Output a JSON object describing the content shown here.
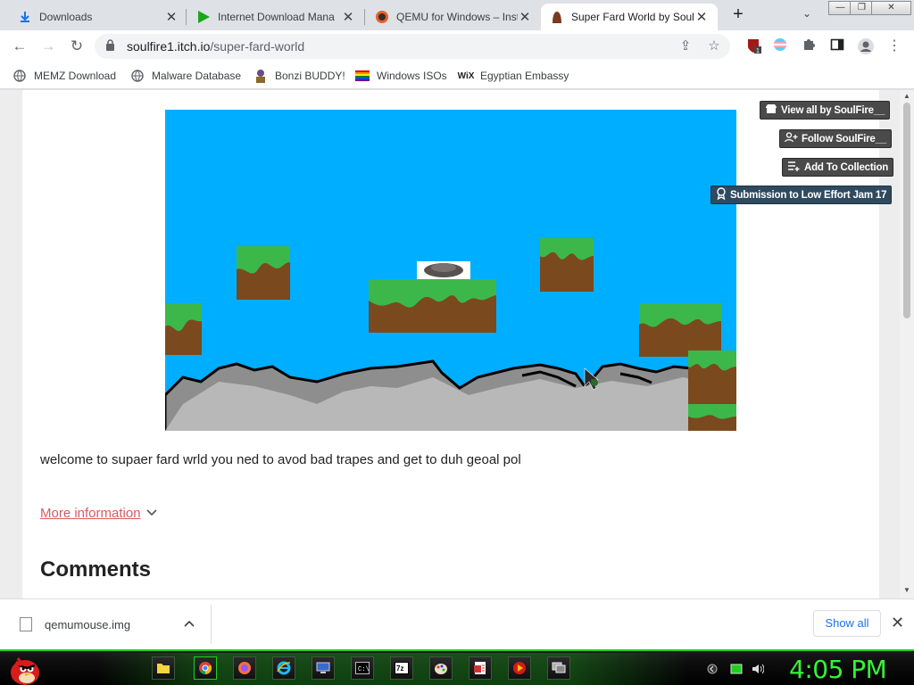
{
  "browser": {
    "tabs": [
      {
        "title": "Downloads",
        "icon": "download-icon",
        "active": false
      },
      {
        "title": "Internet Download Mana",
        "icon": "idm-play-icon",
        "active": false
      },
      {
        "title": "QEMU for Windows – Inst",
        "icon": "qemu-icon",
        "active": false
      },
      {
        "title": "Super Fard World by Soul",
        "icon": "itch-page-icon",
        "active": true
      }
    ],
    "new_tab_label": "+",
    "tab_search_label": "⌄",
    "url_host": "soulfire1.itch.io",
    "url_path": "/super-fard-world",
    "extension_badge": "1",
    "window_controls": {
      "minimize": "—",
      "restore": "❐",
      "close": "✕"
    }
  },
  "bookmarks": [
    {
      "label": "MEMZ Download",
      "icon": "globe-icon"
    },
    {
      "label": "Malware Database",
      "icon": "globe-icon"
    },
    {
      "label": "Bonzi BUDDY!",
      "icon": "bonzi-icon"
    },
    {
      "label": "Windows ISOs",
      "icon": "rainbow-flag-icon"
    },
    {
      "label": "Egyptian Embassy",
      "icon": "wix-icon"
    }
  ],
  "page": {
    "description": "welcome to supaer fard wrld you ned to avod bad trapes and get to duh geoal pol",
    "more_info": "More information",
    "comments_heading": "Comments",
    "actions": {
      "view_all": "View all by SoulFire__",
      "follow": "Follow SoulFire__",
      "add_collection": "Add To Collection",
      "jam": "Submission to Low Effort Jam 17"
    }
  },
  "downloads": {
    "filename": "qemumouse.img",
    "show_all": "Show all"
  },
  "taskbar": {
    "clock": "4:05 PM",
    "icons": [
      "folder-icon",
      "chrome-icon",
      "firefox-icon",
      "ie-icon",
      "monitor-icon",
      "cmd-icon",
      "7zip-icon",
      "paint-icon",
      "office-icon",
      "media-icon",
      "display-icon"
    ],
    "colors": {
      "accent": "#35f535"
    }
  }
}
